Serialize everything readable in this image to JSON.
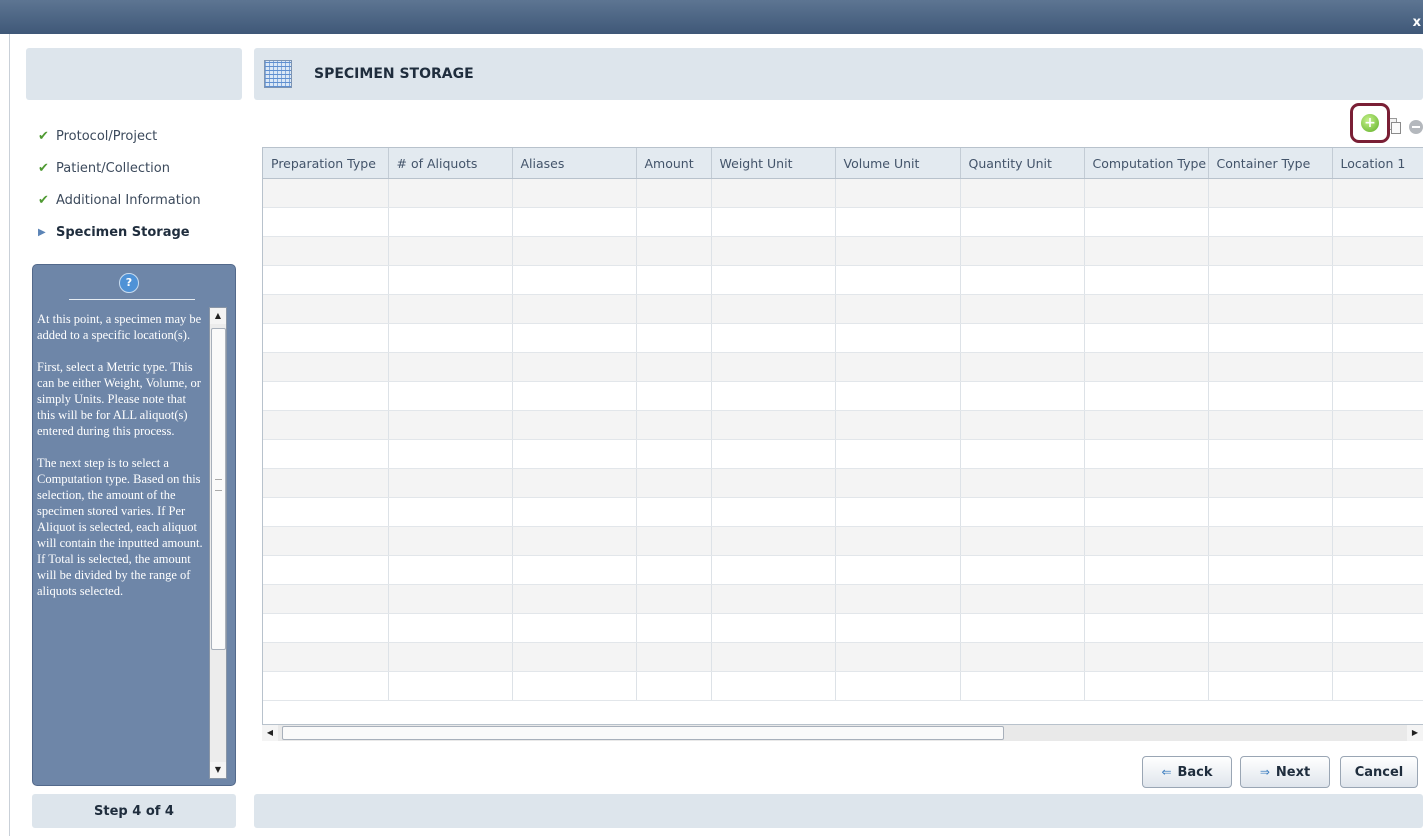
{
  "window": {
    "close_label": "x"
  },
  "wizard": {
    "steps": [
      {
        "label": "Protocol/Project",
        "state": "done"
      },
      {
        "label": "Patient/Collection",
        "state": "done"
      },
      {
        "label": "Additional Information",
        "state": "done"
      },
      {
        "label": "Specimen Storage",
        "state": "active"
      }
    ],
    "help_icon": "?",
    "help_text": "At this point, a specimen may be added to a specific location(s).\n\nFirst, select a Metric type. This can be either Weight, Volume, or simply Units. Please note that this will be for ALL aliquot(s) entered during this process.\n\nThe next step is to select a Computation type.  Based on this selection, the amount of the specimen stored varies.  If Per Aliquot is selected, each aliquot will contain the inputted amount.  If Total is selected, the amount will be divided by the range of aliquots selected.",
    "step_counter": "Step 4 of 4"
  },
  "main": {
    "title": "SPECIMEN STORAGE",
    "columns": [
      "Preparation Type",
      "# of Aliquots",
      "Aliases",
      "Amount",
      "Weight Unit",
      "Volume Unit",
      "Quantity Unit",
      "Computation Type",
      "Container Type",
      "Location 1"
    ],
    "row_count": 18,
    "toolbar": {
      "copy_icon": "copy-icon",
      "add_icon": "add-row-icon",
      "remove_icon": "remove-row-icon"
    }
  },
  "buttons": {
    "back": "Back",
    "next": "Next",
    "cancel": "Cancel"
  }
}
